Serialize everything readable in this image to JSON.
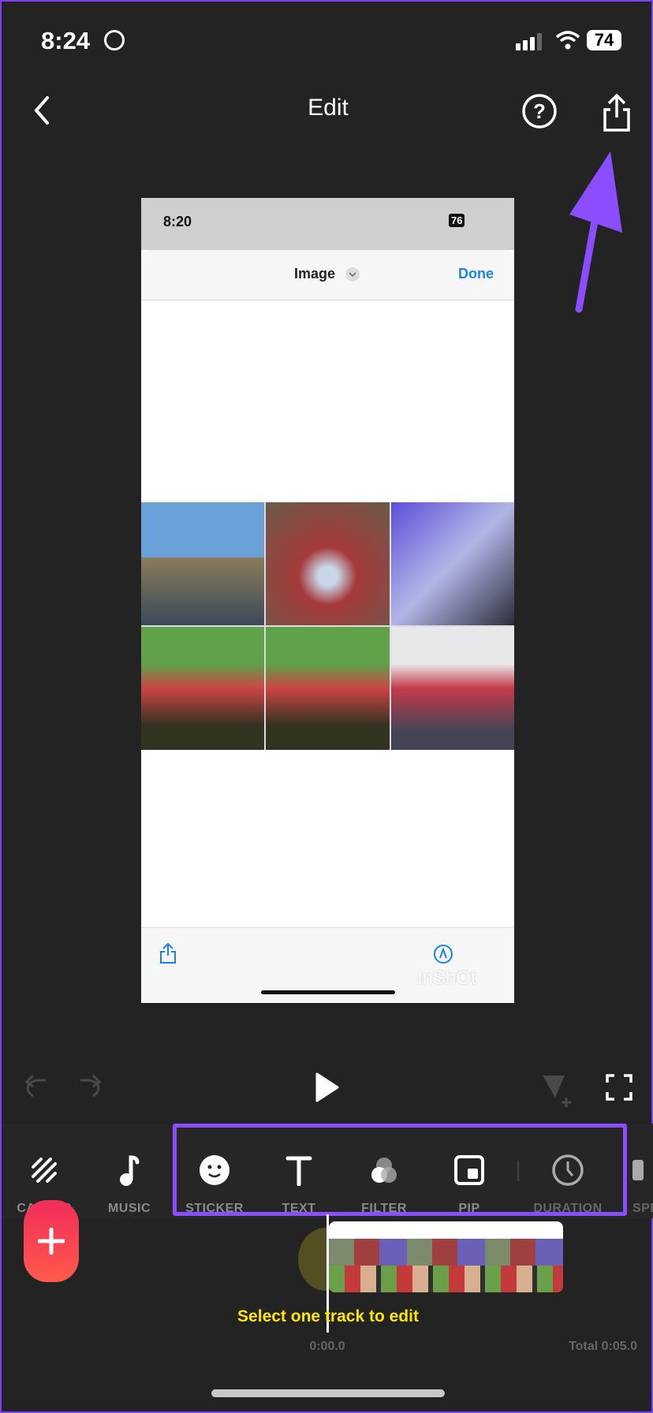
{
  "status_bar": {
    "time": "8:24",
    "battery": "74"
  },
  "header": {
    "title": "Edit",
    "icons": [
      "back-chevron-icon",
      "help-icon",
      "share-icon"
    ]
  },
  "preview": {
    "status_time": "8:20",
    "status_battery": "76",
    "sheet_title": "Image",
    "done_label": "Done",
    "watermark": "InShOt"
  },
  "controls": {
    "icons": [
      "undo-icon",
      "redo-icon",
      "play-icon",
      "add-keyframe-icon",
      "fullscreen-icon"
    ]
  },
  "toolbar": {
    "items": [
      {
        "label": "CANVAS",
        "icon": "canvas-icon"
      },
      {
        "label": "MUSIC",
        "icon": "music-note-icon"
      },
      {
        "label": "STICKER",
        "icon": "smiley-icon"
      },
      {
        "label": "TEXT",
        "icon": "text-icon"
      },
      {
        "label": "FILTER",
        "icon": "filter-icon"
      },
      {
        "label": "PIP",
        "icon": "pip-icon"
      },
      {
        "label": "DURATION",
        "icon": "clock-icon"
      },
      {
        "label": "SPEED",
        "icon": "speed-icon"
      }
    ]
  },
  "timeline": {
    "hint": "Select one track to edit",
    "current_time": "0:00.0",
    "total": "Total 0:05.0"
  },
  "colors": {
    "accent": "#8b4dff",
    "add_button": "#f23d5c",
    "hint": "#ffe600",
    "background": "#232323"
  }
}
